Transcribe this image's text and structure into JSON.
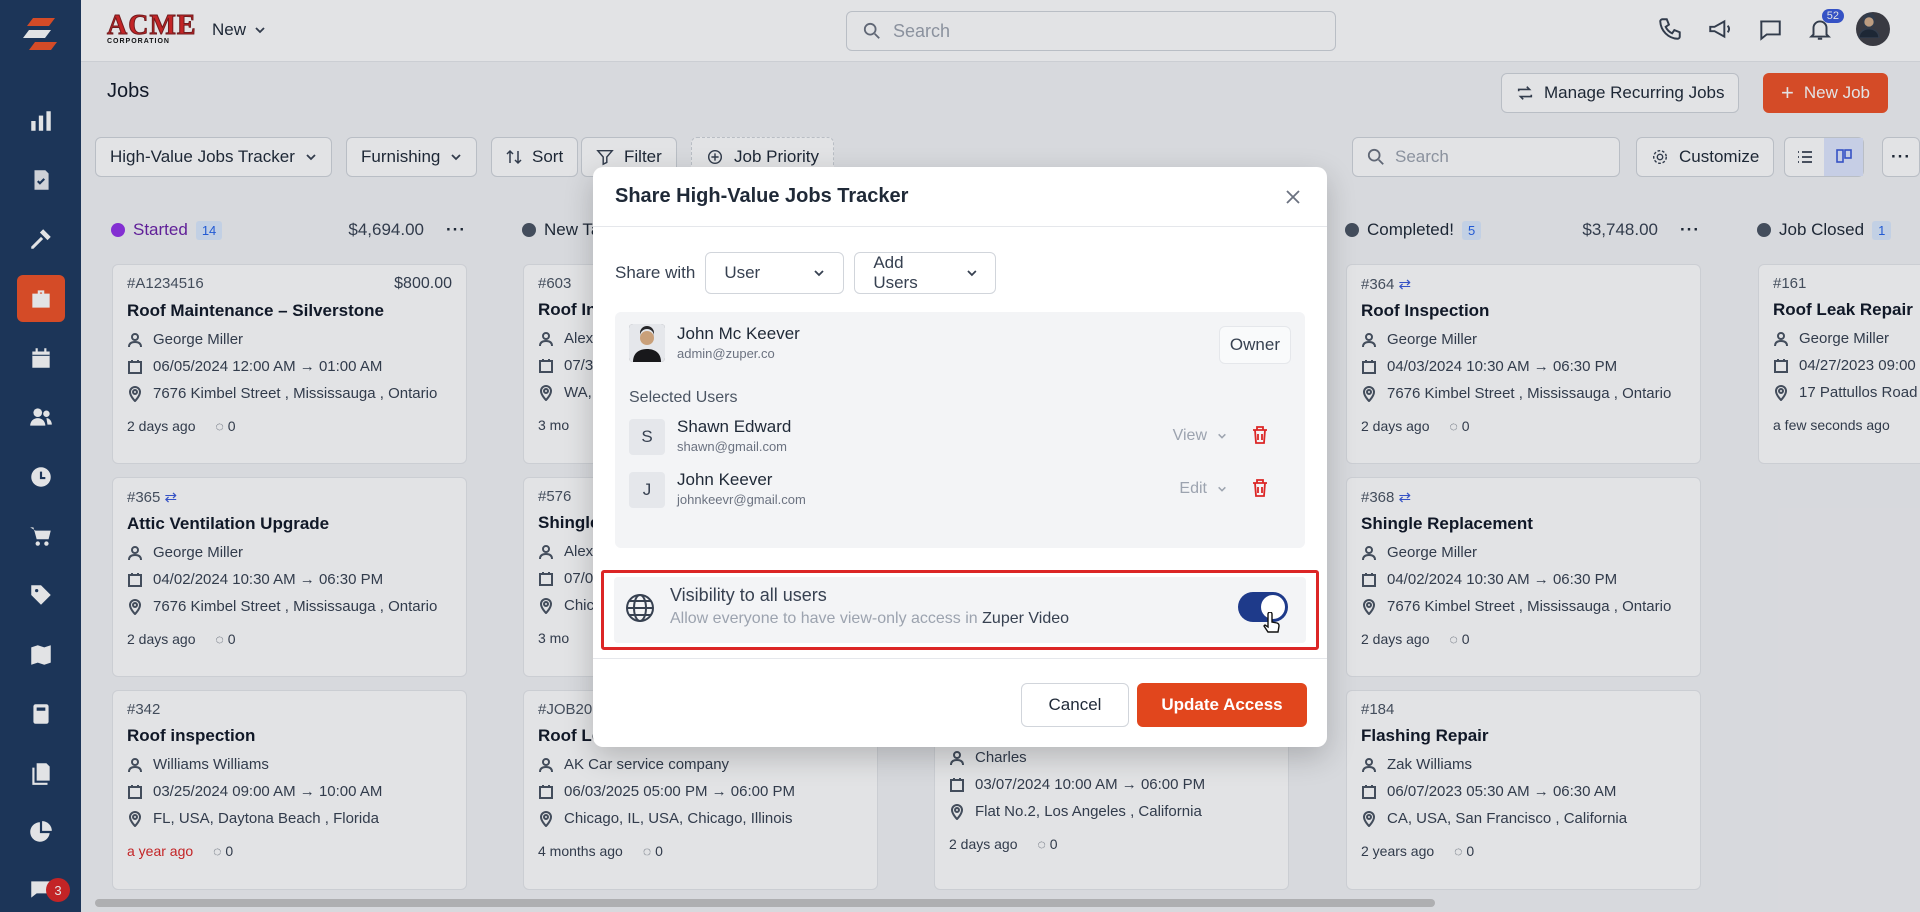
{
  "colors": {
    "sidebar": "#1e3a5f",
    "accent": "#ef5327",
    "started_dot": "#9333ea",
    "neutral_dot": "#4b5563",
    "toggle_on": "#1e3a8a",
    "highlight_border": "#dc2626"
  },
  "header": {
    "logo_big": "ACME",
    "logo_small": "CORPORATION",
    "new_label": "New",
    "search_placeholder": "Search",
    "notification_count": "52"
  },
  "sidebar": {
    "icons": [
      "dashboard-icon",
      "jobs-check-icon",
      "tools-icon",
      "briefcase-icon",
      "calendar-icon",
      "users-icon",
      "clock-icon",
      "cart-icon",
      "tag-icon",
      "map-icon",
      "calculator-icon",
      "documents-icon",
      "pie-chart-icon",
      "chat-icon"
    ],
    "chat_badge": "3"
  },
  "page": {
    "title": "Jobs",
    "manage_recurring": "Manage Recurring Jobs",
    "new_job": "New Job"
  },
  "filters": {
    "view": "High-Value Jobs Tracker",
    "category": "Furnishing",
    "sort": "Sort",
    "filter": "Filter",
    "priority": "Job Priority",
    "search_placeholder": "Search",
    "customize": "Customize"
  },
  "columns": {
    "started": {
      "name": "Started",
      "count": "14",
      "amount": "$4,694.00"
    },
    "new": {
      "name": "New Ta"
    },
    "completed": {
      "name": "Completed!",
      "count": "5",
      "amount": "$3,748.00"
    },
    "closed": {
      "name": "Job Closed",
      "count": "1"
    }
  },
  "cards": {
    "c1": {
      "id": "#A1234516",
      "amount": "$800.00",
      "title": "Roof Maintenance – Silverstone",
      "person": "George Miller",
      "time": "06/05/2024 12:00 AM → 01:00 AM",
      "address": "7676 Kimbel Street , Mississauga , Ontario",
      "ago": "2 days ago",
      "comments": "0"
    },
    "c2": {
      "id": "#365",
      "title": "Attic Ventilation Upgrade",
      "person": "George Miller",
      "time": "04/02/2024 10:30 AM → 06:30 PM",
      "address": "7676 Kimbel Street , Mississauga , Ontario",
      "ago": "2 days ago",
      "comments": "0"
    },
    "c3": {
      "id": "#342",
      "title": "Roof inspection",
      "person": "Williams Williams",
      "time": "03/25/2024 09:00 AM → 10:00 AM",
      "address": "FL, USA, Daytona Beach , Florida",
      "ago": "a year ago",
      "comments": "0"
    },
    "n1": {
      "id": "#603",
      "title": "Roof Ins",
      "person": "Alex",
      "time": "07/3",
      "address": "WA,",
      "ago": "3 mo"
    },
    "n2": {
      "id": "#576",
      "title": "Shingle",
      "person": "Alex",
      "time": "07/0",
      "address": "Chic",
      "ago": "3 mo"
    },
    "n3": {
      "id": "#JOB20",
      "title": "Roof Le",
      "person": "AK Car service company",
      "time": "06/03/2025 05:00 PM → 06:00 PM",
      "address": "Chicago, IL, USA, Chicago, Illinois",
      "ago": "4 months ago",
      "comments": "0"
    },
    "m3": {
      "person": "Charles",
      "time": "03/07/2024 10:00 AM → 06:00 PM",
      "address": "Flat No.2, Los Angeles , California",
      "ago": "2 days ago",
      "comments": "0"
    },
    "d1": {
      "id": "#364",
      "title": "Roof Inspection",
      "person": "George Miller",
      "time": "04/03/2024 10:30 AM → 06:30 PM",
      "address": "7676 Kimbel Street , Mississauga , Ontario",
      "ago": "2 days ago",
      "comments": "0"
    },
    "d2": {
      "id": "#368",
      "title": "Shingle Replacement",
      "person": "George Miller",
      "time": "04/02/2024 10:30 AM → 06:30 PM",
      "address": "7676 Kimbel Street , Mississauga , Ontario",
      "ago": "2 days ago",
      "comments": "0"
    },
    "d3": {
      "id": "#184",
      "title": "Flashing Repair",
      "person": "Zak Williams",
      "time": "06/07/2023 05:30 AM → 06:30 AM",
      "address": "CA, USA, San Francisco , California",
      "ago": "2 years ago",
      "comments": "0"
    },
    "e1": {
      "id": "#161",
      "title": "Roof Leak Repair",
      "person": "George Miller",
      "time": "04/27/2023 09:00",
      "address": "17 Pattullos Road ,",
      "ago": "a few seconds ago"
    }
  },
  "modal": {
    "title": "Share High-Value Jobs Tracker",
    "share_with_label": "Share with",
    "share_with_value": "User",
    "add_users": "Add Users",
    "owner": {
      "name": "John Mc Keever",
      "email": "admin@zuper.co",
      "role": "Owner"
    },
    "selected_label": "Selected Users",
    "users": [
      {
        "initial": "S",
        "name": "Shawn Edward",
        "email": "shawn@gmail.com",
        "permission": "View"
      },
      {
        "initial": "J",
        "name": "John Keever",
        "email": "johnkeevr@gmail.com",
        "permission": "Edit"
      }
    ],
    "visibility_title": "Visibility to all users",
    "visibility_desc": "Allow everyone to have view-only access in",
    "visibility_app": "Zuper Video",
    "visibility_on": true,
    "cancel": "Cancel",
    "update": "Update Access"
  }
}
